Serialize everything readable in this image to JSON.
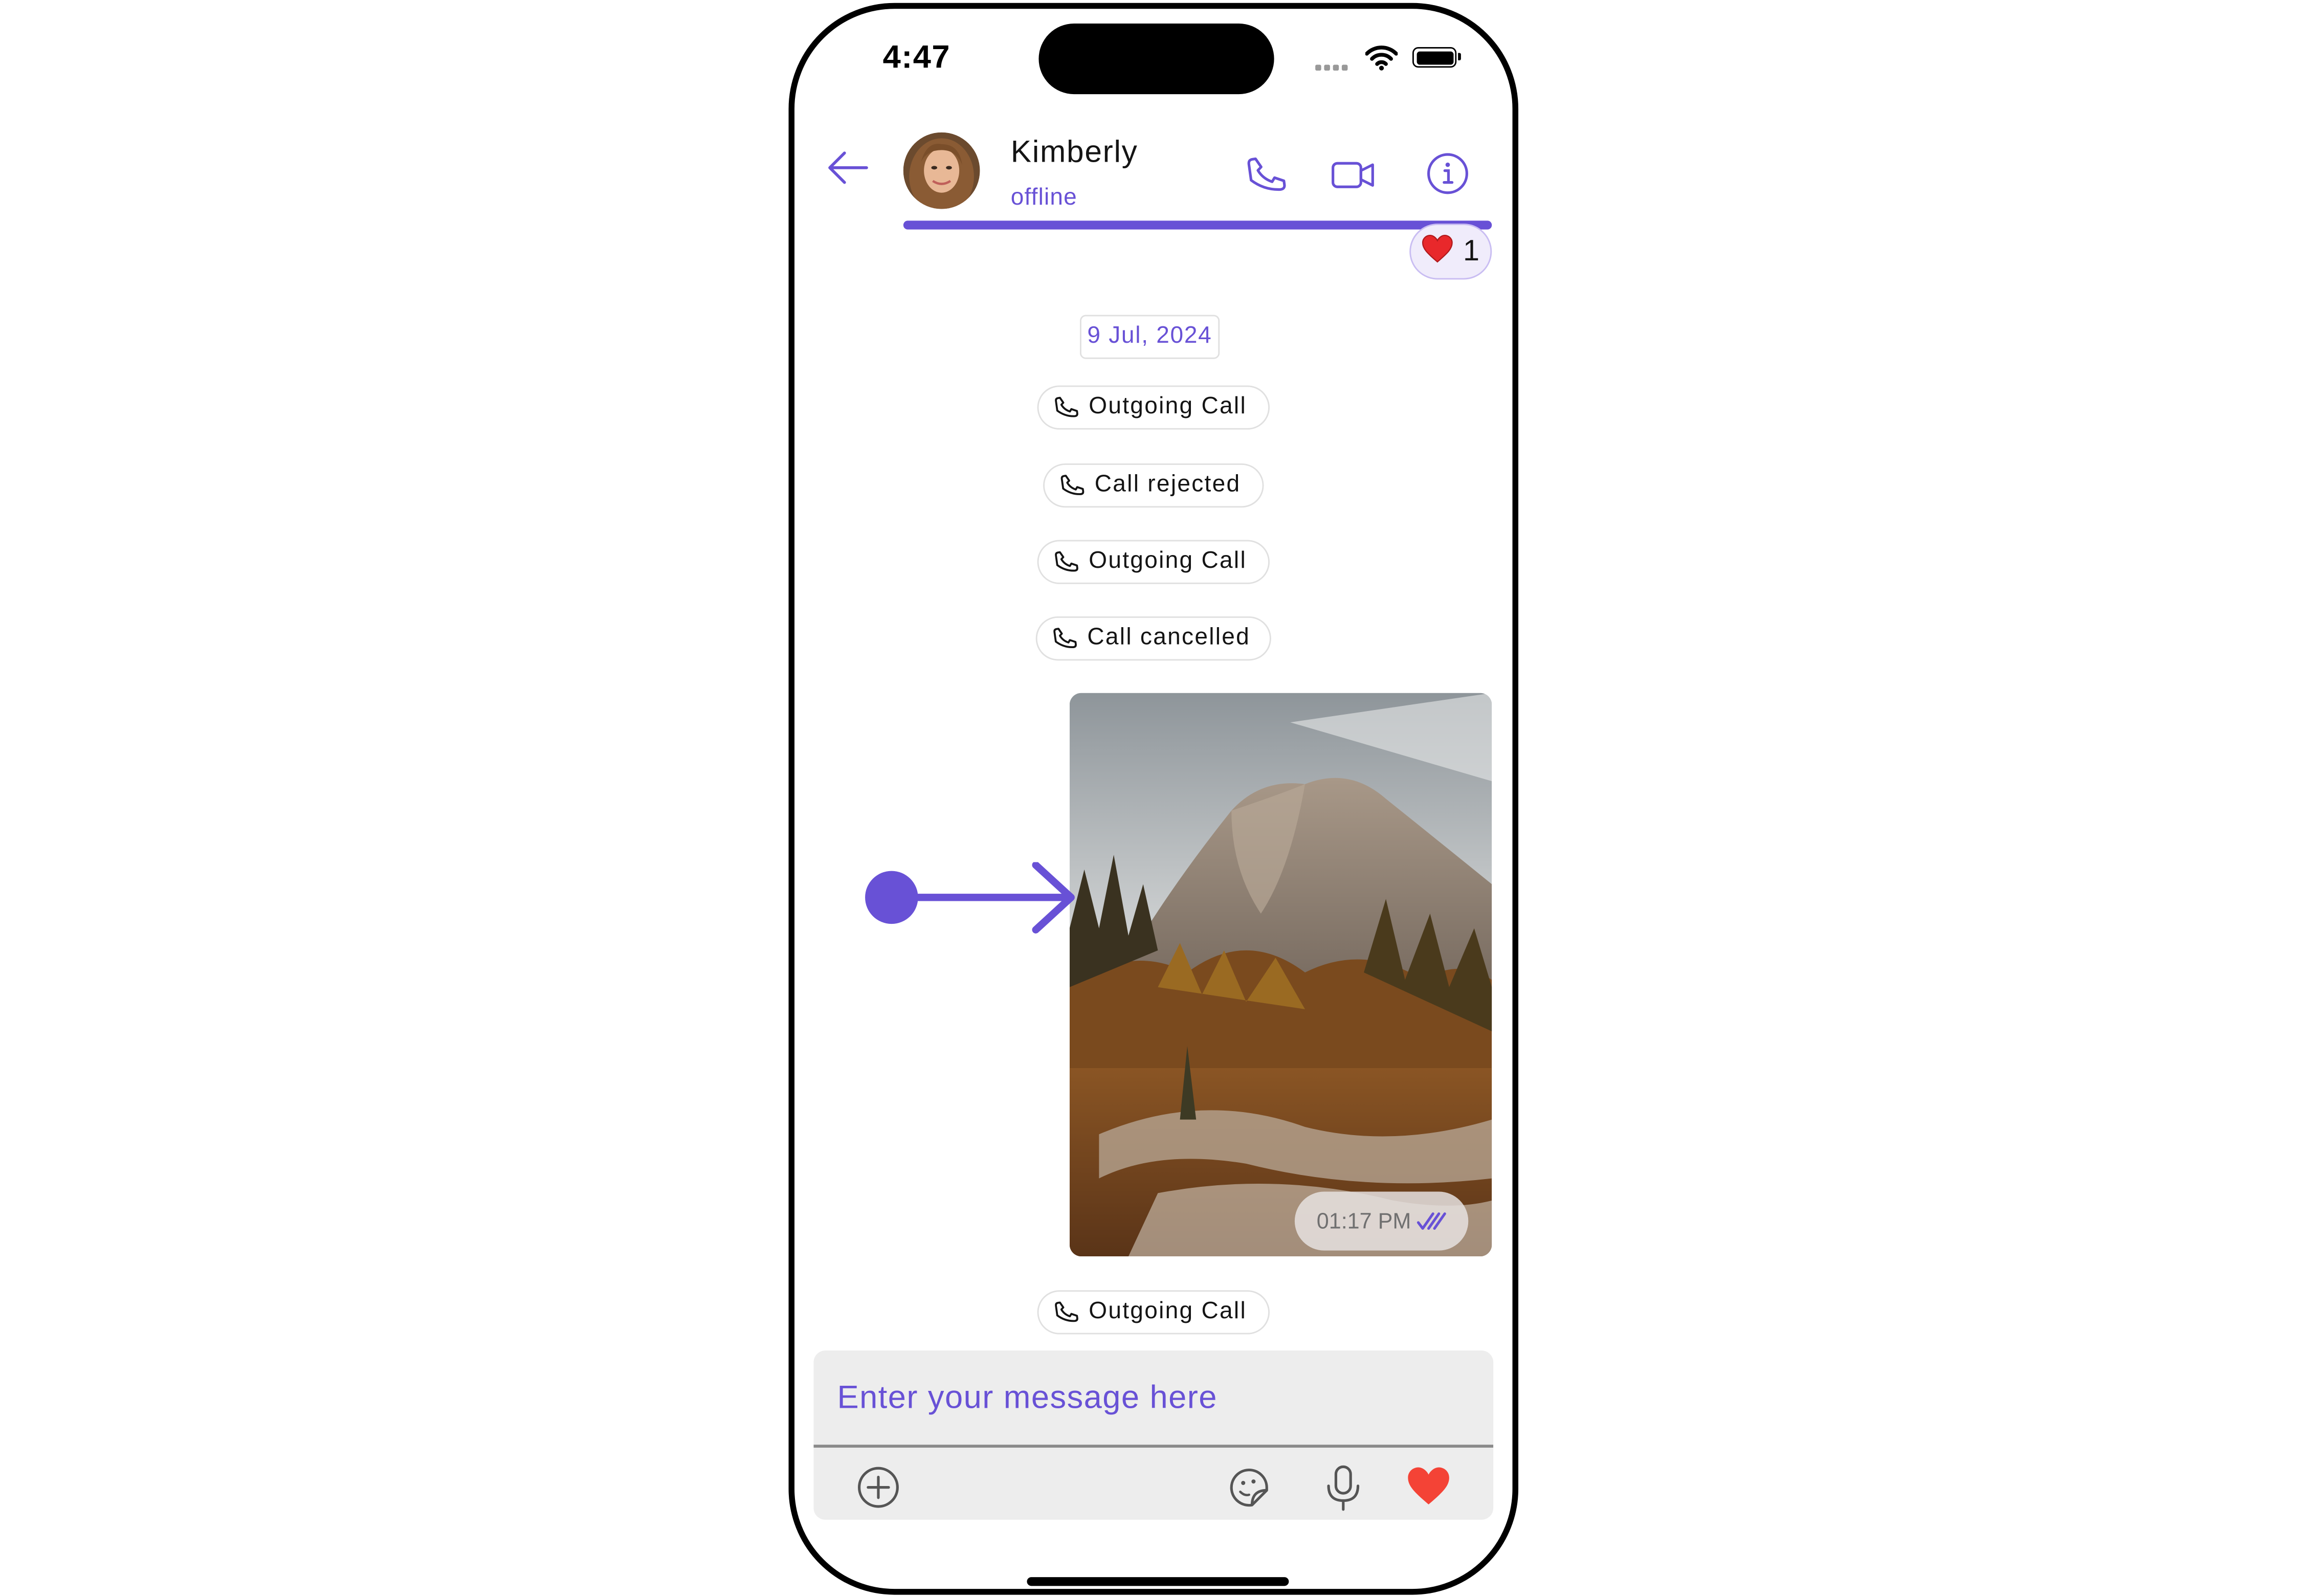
{
  "status_bar": {
    "time": "4:47"
  },
  "header": {
    "contact_name": "Kimberly",
    "contact_status": "offline",
    "reaction": {
      "emoji": "❤️",
      "count": "1"
    }
  },
  "messages": {
    "date_separator": "9 Jul, 2024",
    "calls": [
      "Outgoing Call",
      "Call rejected",
      "Outgoing Call",
      "Call cancelled"
    ],
    "image_message": {
      "time": "01:17 PM",
      "receipt": "read"
    },
    "last_call": "Outgoing Call"
  },
  "composer": {
    "placeholder": "Enter your message here"
  },
  "colors": {
    "accent": "#6851d6",
    "heart": "#f44336",
    "composer_bg": "#ededed"
  }
}
